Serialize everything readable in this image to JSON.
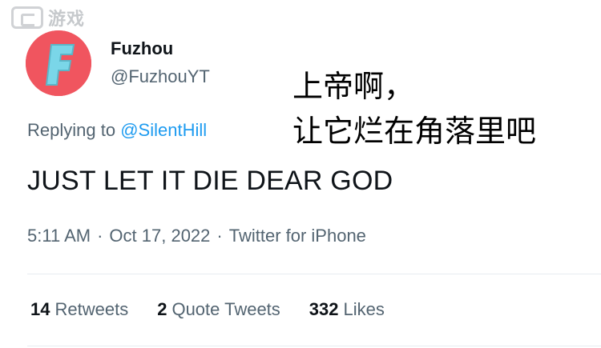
{
  "watermark": {
    "text": "游戏"
  },
  "author": {
    "name": "Fuzhou",
    "handle": "@FuzhouYT",
    "avatar_letter": "F",
    "avatar_color": "#f0555f",
    "avatar_letter_color": "#7ad6e8"
  },
  "caption": {
    "line1": "上帝啊，",
    "line2": "让它烂在角落里吧"
  },
  "reply": {
    "prefix": "Replying to",
    "target": "@SilentHill"
  },
  "tweet": {
    "text": "JUST LET IT DIE DEAR GOD"
  },
  "meta": {
    "time": "5:11 AM",
    "sep1": "·",
    "date": "Oct 17, 2022",
    "sep2": "·",
    "source": "Twitter for iPhone"
  },
  "stats": {
    "retweets_count": "14",
    "retweets_label": "Retweets",
    "quotes_count": "2",
    "quotes_label": "Quote Tweets",
    "likes_count": "332",
    "likes_label": "Likes"
  },
  "colors": {
    "link": "#1d9bf0",
    "secondary_text": "#536471",
    "primary_text": "#0f1419"
  }
}
